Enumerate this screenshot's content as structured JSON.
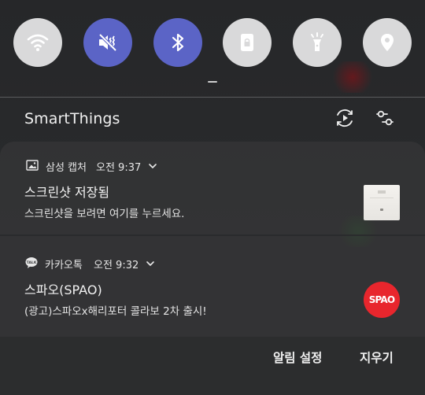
{
  "quick_settings": [
    {
      "name": "wifi-icon",
      "active": false
    },
    {
      "name": "vibrate-icon",
      "active": true
    },
    {
      "name": "bluetooth-icon",
      "active": true
    },
    {
      "name": "rotation-lock-icon",
      "active": false
    },
    {
      "name": "flashlight-icon",
      "active": false
    },
    {
      "name": "location-icon",
      "active": false
    }
  ],
  "smartthings": {
    "label": "SmartThings",
    "icons": [
      "media-output-icon",
      "device-control-icon"
    ]
  },
  "notifications": [
    {
      "app": "삼성 캡처",
      "time": "오전 9:37",
      "title": "스크린샷 저장됨",
      "text": "스크린샷을 보려면 여기를 누르세요."
    },
    {
      "app": "카카오톡",
      "time": "오전 9:32",
      "title": "스파오(SPAO)",
      "text": "(광고)스파오x해리포터 콜라보 2차 출시!",
      "thumb_label": "SPAO"
    }
  ],
  "actions": {
    "settings": "알림 설정",
    "clear": "지우기"
  },
  "colors": {
    "active_tile": "#5b64c6",
    "inactive_tile": "#d9d9da",
    "spao_red": "#e8262d"
  }
}
